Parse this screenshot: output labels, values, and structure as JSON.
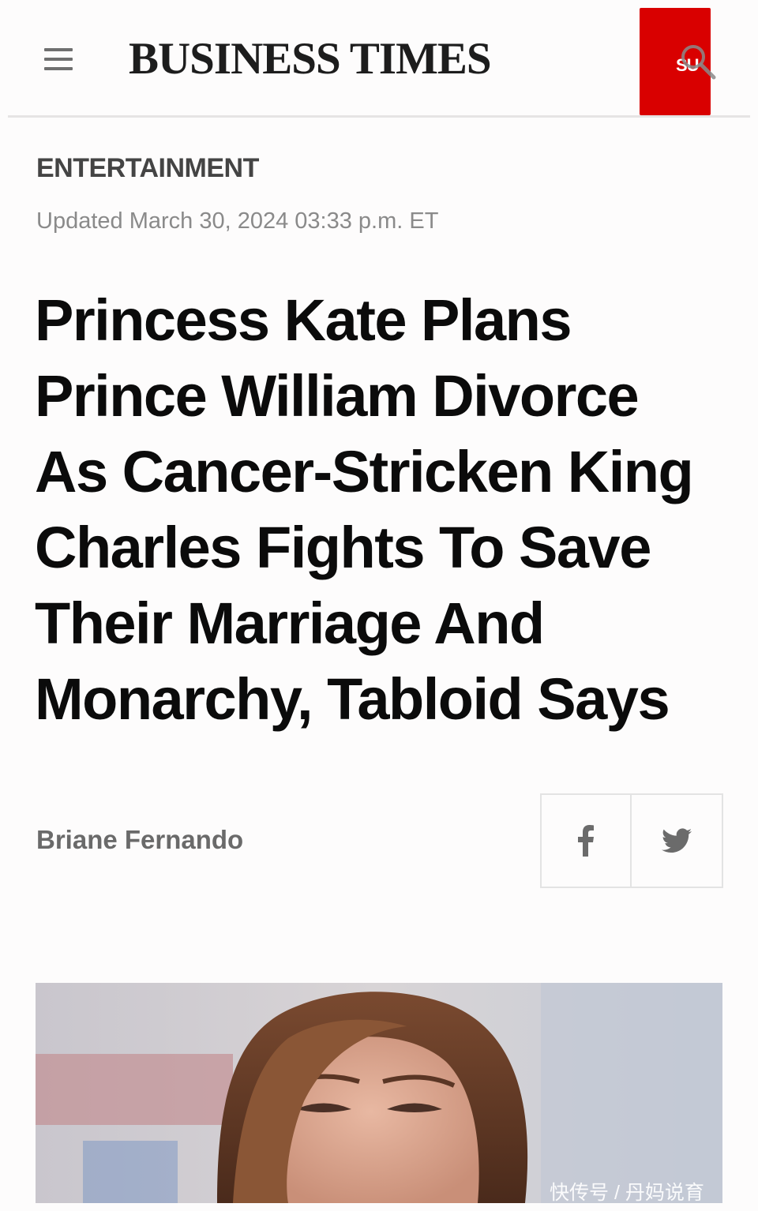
{
  "header": {
    "brand": "BUSINESS TIMES",
    "subscribe_label": "SU",
    "accent_color": "#d90000",
    "icons": {
      "menu": "hamburger-menu-icon",
      "search": "search-icon"
    }
  },
  "article": {
    "category": "ENTERTAINMENT",
    "updated": "Updated March 30, 2024 03:33 p.m. ET",
    "headline_lines": [
      "Princess Kate Plans",
      "Prince William Divorce",
      "As Cancer-Stricken King",
      "Charles Fights To Save",
      "Their Marriage And",
      "Monarchy, Tabloid Says"
    ],
    "author": "Briane Fernando",
    "share": {
      "icons": [
        "facebook-icon",
        "twitter-icon"
      ]
    }
  },
  "watermark": "快传号 / 丹妈说育"
}
